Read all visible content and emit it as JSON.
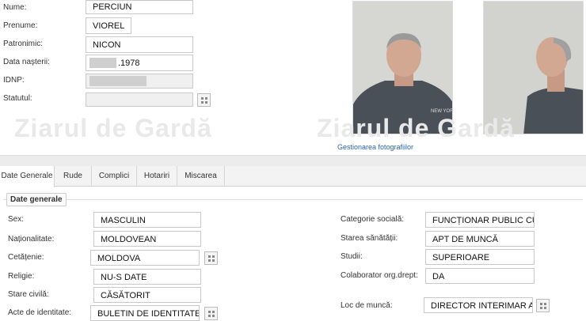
{
  "personal": {
    "nume_label": "Nume:",
    "nume_value": "PERCIUN",
    "prenume_label": "Prenume:",
    "prenume_value": "VIOREL",
    "patronimic_label": "Patronimic:",
    "patronimic_value": "NICON",
    "data_nasterii_label": "Data nașterii:",
    "data_nasterii_value": ".1978",
    "idnp_label": "IDNP:",
    "idnp_value": "",
    "statutul_label": "Statutul:",
    "statutul_value": ""
  },
  "watermark": {
    "text_left": "Ziarul de Gardă",
    "text_right": "Ziarul de Gardă"
  },
  "photos": {
    "manage_link": "Gestionarea fotografiilor"
  },
  "tabs": [
    "Date Generale",
    "Rude",
    "Complici",
    "Hotariri",
    "Miscarea"
  ],
  "section": {
    "title": "Date generale"
  },
  "left_fields": {
    "sex_label": "Sex:",
    "sex_value": "MASCULIN",
    "nationalitate_label": "Naționalitate:",
    "nationalitate_value": "MOLDOVEAN",
    "cetatenie_label": "Cetățenie:",
    "cetatenie_value": "MOLDOVA",
    "religie_label": "Religie:",
    "religie_value": "NU-S DATE",
    "stare_civila_label": "Stare civilă:",
    "stare_civila_value": "CĂSĂTORIT",
    "acte_label": "Acte de identitate:",
    "acte_value": "BULETIN DE IDENTITATE"
  },
  "right_fields": {
    "categorie_label": "Categorie socială:",
    "categorie_value": "FUNCȚIONAR PUBLIC CU S",
    "stare_sanatate_label": "Starea sănătății:",
    "stare_sanatate_value": "APT DE MUNCĂ",
    "studii_label": "Studii:",
    "studii_value": "SUPERIOARE",
    "colaborator_label": "Colaborator org.drept:",
    "colaborator_value": "DA",
    "loc_munca_label": "Loc de muncă:",
    "loc_munca_value": "DIRECTOR INTERIMAR AL F"
  },
  "colors": {
    "accent_link": "#2a63b0",
    "watermark": "#e9e9e9"
  }
}
